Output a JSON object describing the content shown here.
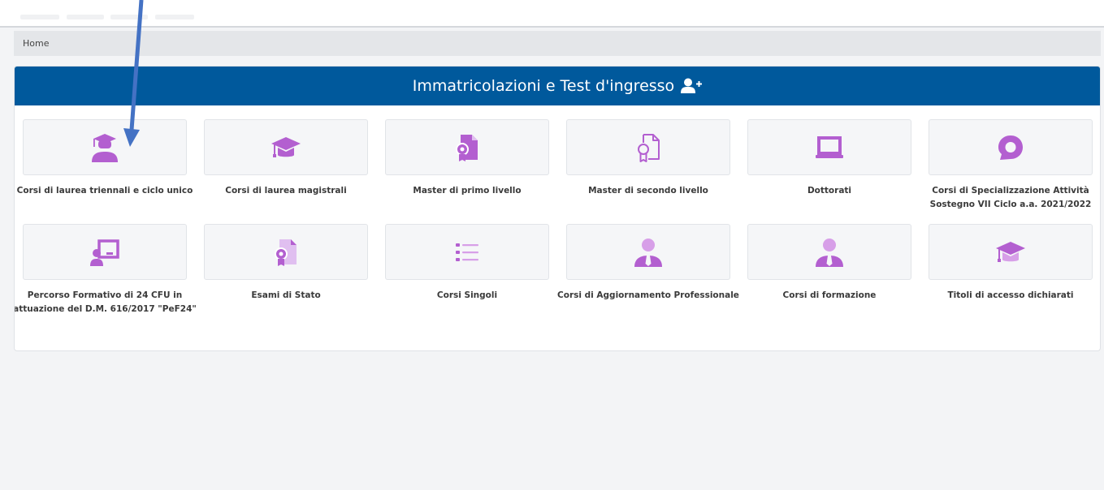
{
  "breadcrumb": {
    "home": "Home"
  },
  "header": {
    "title": "Immatricolazioni e Test d'ingresso",
    "icon": "user-plus-icon"
  },
  "colors": {
    "header_bg": "#00599c",
    "icon_color": "#b35fd0",
    "icon_light": "#e0bff0"
  },
  "tiles": [
    {
      "label": "Corsi di laurea triennali e ciclo unico",
      "icon": "graduate-student-icon"
    },
    {
      "label": "Corsi di laurea magistrali",
      "icon": "graduation-cap-icon"
    },
    {
      "label": "Master di primo livello",
      "icon": "certificate-icon"
    },
    {
      "label": "Master di secondo livello",
      "icon": "certificate-outline-icon"
    },
    {
      "label": "Dottorati",
      "icon": "laptop-icon"
    },
    {
      "label": "Corsi di Specializzazione Attività Sostegno VII Ciclo a.a. 2021/2022",
      "icon": "speech-bubble-icon"
    },
    {
      "label": "Percorso Formativo di 24 CFU in attuazione del D.M. 616/2017 \"PeF24\"",
      "icon": "teacher-board-icon"
    },
    {
      "label": "Esami di Stato",
      "icon": "certificate-icon"
    },
    {
      "label": "Corsi Singoli",
      "icon": "list-icon"
    },
    {
      "label": "Corsi di Aggiornamento Professionale",
      "icon": "user-tie-icon"
    },
    {
      "label": "Corsi di formazione",
      "icon": "user-tie-icon"
    },
    {
      "label": "Titoli di accesso dichiarati",
      "icon": "graduation-cap-icon"
    }
  ]
}
